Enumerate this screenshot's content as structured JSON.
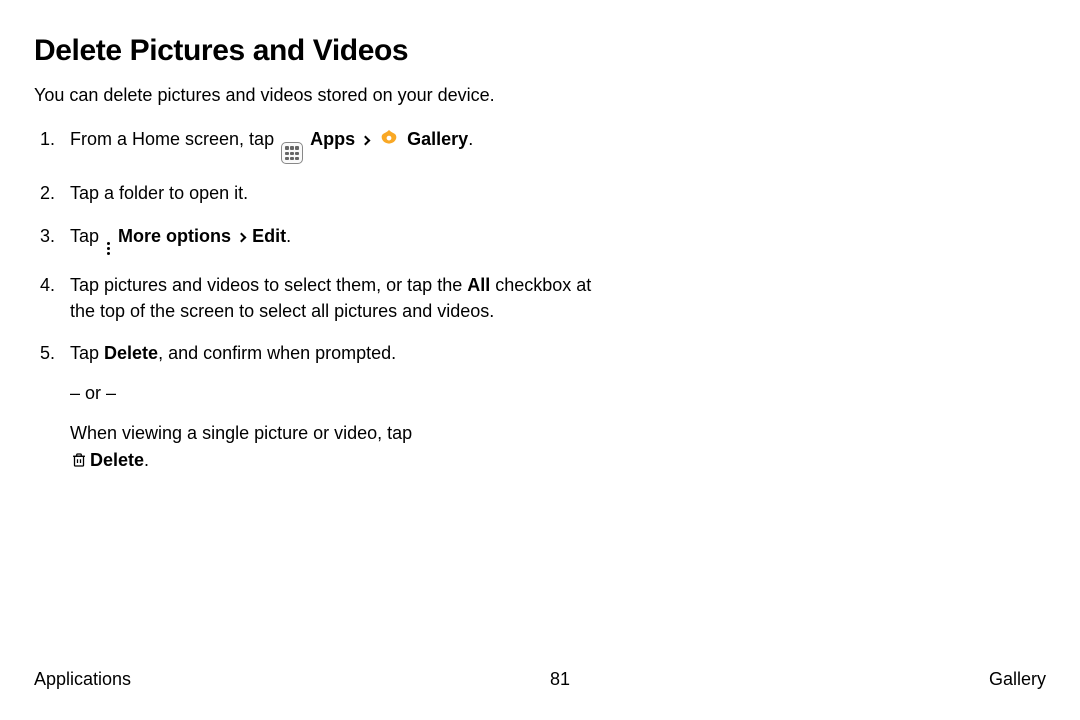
{
  "title": "Delete Pictures and Videos",
  "intro": "You can delete pictures and videos stored on your device.",
  "step1": {
    "pre": "From a Home screen, tap ",
    "apps": "Apps",
    "gallery": "Gallery",
    "end": "."
  },
  "step2": "Tap a folder to open it.",
  "step3": {
    "pre": "Tap ",
    "more": "More options",
    "edit": "Edit",
    "end": "."
  },
  "step4": {
    "a": "Tap pictures and videos to select them, or tap the ",
    "all": "All",
    "b": " checkbox at the top of the screen to select all pictures and videos."
  },
  "step5": {
    "a1": "Tap ",
    "delete1": "Delete",
    "a2": ", and confirm when prompted.",
    "or": "– or –",
    "b1": "When viewing a single picture or video, tap",
    "delete2": "Delete",
    "b2": "."
  },
  "footer": {
    "left": "Applications",
    "center": "81",
    "right": "Gallery"
  }
}
